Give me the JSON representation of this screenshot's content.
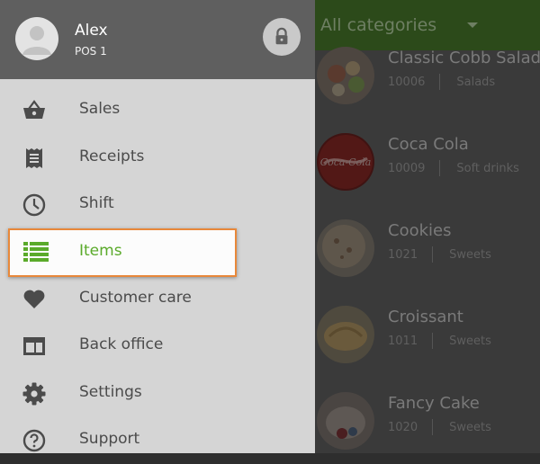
{
  "header": {
    "category": "All categories"
  },
  "items": [
    {
      "name": "Classic Cobb Salad",
      "code": "10006",
      "category": "Salads"
    },
    {
      "name": "Coca Cola",
      "code": "10009",
      "category": "Soft drinks"
    },
    {
      "name": "Cookies",
      "code": "1021",
      "category": "Sweets"
    },
    {
      "name": "Croissant",
      "code": "1011",
      "category": "Sweets"
    },
    {
      "name": "Fancy Cake",
      "code": "1020",
      "category": "Sweets"
    }
  ],
  "drawer": {
    "user_name": "Alex",
    "pos_name": "POS 1",
    "menu": [
      {
        "label": "Sales",
        "icon": "basket-icon"
      },
      {
        "label": "Receipts",
        "icon": "receipt-icon"
      },
      {
        "label": "Shift",
        "icon": "clock-icon"
      },
      {
        "label": "Items",
        "icon": "list-icon",
        "active": true
      },
      {
        "label": "Customer care",
        "icon": "heart-icon"
      },
      {
        "label": "Back office",
        "icon": "back-office-icon"
      },
      {
        "label": "Settings",
        "icon": "gear-icon"
      },
      {
        "label": "Support",
        "icon": "help-icon"
      }
    ]
  },
  "colors": {
    "accent_green": "#5aaa2a",
    "highlight_border": "#e8883a",
    "drawer_header": "#5f5f5f",
    "drawer_bg": "#d5d5d5"
  }
}
